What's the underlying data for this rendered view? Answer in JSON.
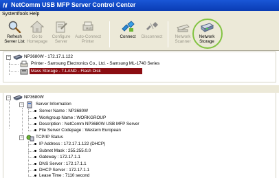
{
  "window": {
    "title": "NetComm USB MFP Server Control Center"
  },
  "menu": [
    "System",
    "Tools",
    "Help"
  ],
  "toolbar": {
    "buttons": [
      {
        "label": "Refresh\nServer List",
        "icon": "refresh-icon",
        "enabled": true
      },
      {
        "label": "Go to\nHomepage",
        "icon": "home-icon",
        "enabled": false
      },
      {
        "label": "Configure\nServer",
        "icon": "configure-icon",
        "enabled": false
      },
      {
        "label": "Auto-Connect\nPrinter",
        "icon": "auto-connect-icon",
        "enabled": false
      },
      {
        "label": "Connect",
        "icon": "connect-icon",
        "enabled": true
      },
      {
        "label": "Disconnect",
        "icon": "disconnect-icon",
        "enabled": false
      },
      {
        "label": "Network\nScanner",
        "icon": "network-scanner-icon",
        "enabled": false
      },
      {
        "label": "Network\nStorage",
        "icon": "network-storage-icon",
        "enabled": true
      }
    ],
    "auto_icon_text": "Auto"
  },
  "device_tree": {
    "server": "NP3680W - 172.17.1.122",
    "printer": "Printer - Samsung Electronics Co., Ltd. - Samsung ML-1740 Series",
    "storage": "Mass Storage - T-LAND    - Flash Disk"
  },
  "info_tree": {
    "root": "NP3680W",
    "server_info": {
      "title": "Server Information",
      "items": [
        "Server Name : NP3680W",
        "Workgroup Name : WORKGROUP",
        "Description : NetComm NP3680W USB MFP Server",
        "File Server Codepage : Western European"
      ]
    },
    "tcpip": {
      "title": "TCP/IP Status",
      "items": [
        "IP Address : 172.17.1.122 (DHCP)",
        "Subnet Mask : 255.255.0.0",
        "Gateway : 172.17.1.1",
        "DNS Server : 172.17.1.1",
        "DHCP Server : 172.17.1.1",
        "Lease Time : 7110 second"
      ]
    }
  },
  "colors": {
    "titlebar": "#0a3cb4",
    "selection": "#8b0d12",
    "highlight_ring": "#82c341",
    "chrome": "#ece9d8"
  }
}
